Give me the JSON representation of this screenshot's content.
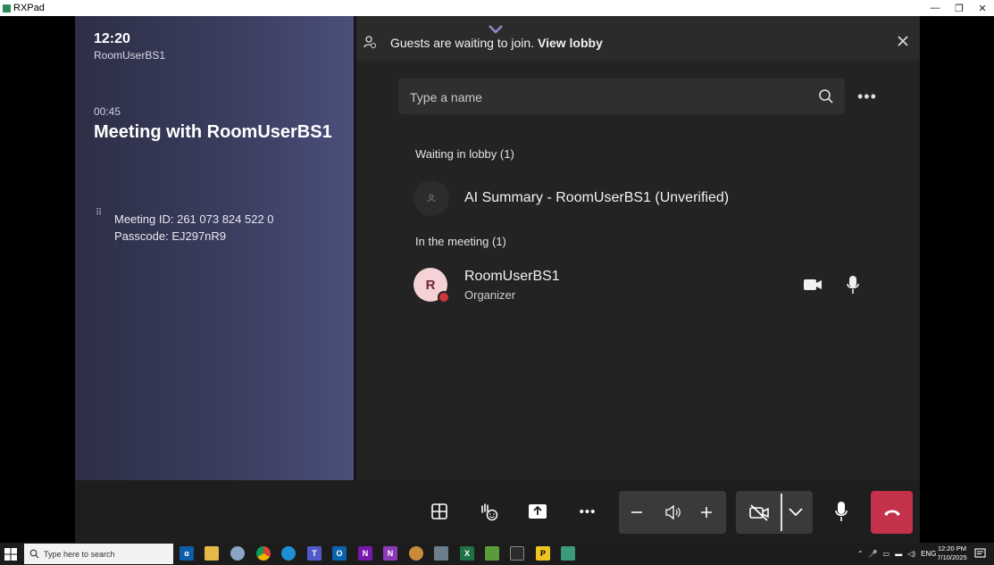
{
  "window": {
    "title": "RXPad",
    "minimize": "—",
    "restore": "❐",
    "close": "✕"
  },
  "left_panel": {
    "clock": "12:20",
    "room_name": "RoomUserBS1",
    "elapsed": "00:45",
    "meeting_title": "Meeting with RoomUserBS1",
    "meeting_id_line": "Meeting ID:  261 073 824 522 0",
    "passcode_line": "Passcode: EJ297nR9"
  },
  "banner": {
    "text_prefix": "Guests are waiting to join.",
    "link": "View lobby"
  },
  "search": {
    "placeholder": "Type a name"
  },
  "lobby": {
    "section_label": "Waiting in lobby (1)",
    "items": [
      {
        "name": "AI Summary - RoomUserBS1 (Unverified)"
      }
    ]
  },
  "meeting": {
    "section_label": "In the meeting (1)",
    "items": [
      {
        "initial": "R",
        "name": "RoomUserBS1",
        "role": "Organizer"
      }
    ]
  },
  "taskbar": {
    "search_placeholder": "Type here to search",
    "language": "ENG",
    "time": "12:20 PM",
    "date": "7/10/2025"
  },
  "colors": {
    "accent_lobby_chevron": "#8b8cc7",
    "hangup": "#c4314b",
    "status_busy": "#d13438",
    "avatar_bg": "#f4d2d6"
  }
}
